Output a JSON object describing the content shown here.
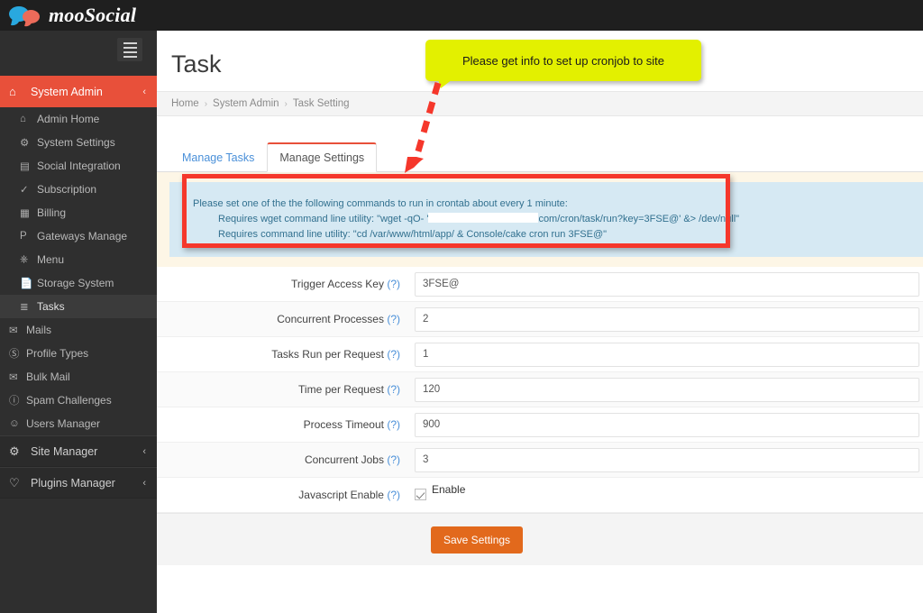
{
  "brand": {
    "name": "mooSocial"
  },
  "sidebar": {
    "toggle_icon": "hamburger-icon",
    "sections": [
      {
        "label": "System Admin",
        "icon": "home-icon",
        "chevron": "‹",
        "active": true
      },
      {
        "label": "Site Manager",
        "icon": "gears-icon",
        "chevron": "‹",
        "active": false
      },
      {
        "label": "Plugins Manager",
        "icon": "plug-icon",
        "chevron": "‹",
        "active": false
      }
    ],
    "items": [
      {
        "label": "Admin Home",
        "icon": "home-outline-icon"
      },
      {
        "label": "System Settings",
        "icon": "gear-icon"
      },
      {
        "label": "Social Integration",
        "icon": "share-icon"
      },
      {
        "label": "Subscription",
        "icon": "check-icon"
      },
      {
        "label": "Billing",
        "icon": "card-icon"
      },
      {
        "label": "Gateways Manage",
        "icon": "paypal-icon"
      },
      {
        "label": "Menu",
        "icon": "sitemap-icon"
      },
      {
        "label": "Storage System",
        "icon": "file-icon"
      },
      {
        "label": "Tasks",
        "icon": "list-icon",
        "active": true
      },
      {
        "label": "Mails",
        "icon": "envelope-icon",
        "flush": true
      },
      {
        "label": "Profile Types",
        "icon": "circle-check-icon",
        "flush": true
      },
      {
        "label": "Bulk Mail",
        "icon": "envelope-icon",
        "flush": true
      },
      {
        "label": "Spam Challenges",
        "icon": "question-circle-icon",
        "flush": true
      },
      {
        "label": "Users Manager",
        "icon": "user-icon",
        "flush": true
      }
    ]
  },
  "page": {
    "title": "Task",
    "breadcrumb": [
      "Home",
      "System Admin",
      "Task Setting"
    ],
    "breadcrumb_separator": "›"
  },
  "tabs": [
    {
      "label": "Manage Tasks",
      "active": false
    },
    {
      "label": "Manage Settings",
      "active": true
    }
  ],
  "alert": {
    "line1": "Please set one of the the following commands to run in crontab about every 1 minute:",
    "line2_prefix": "Requires wget command line utility: \"wget -qO- '",
    "line2_redacted": true,
    "line2_suffix": "com/cron/task/run?key=3FSE@' &> /dev/null\"",
    "line3": "Requires command line utility: \"cd /var/www/html/app/ & Console/cake cron run 3FSE@\""
  },
  "form": {
    "rows": [
      {
        "label": "Trigger Access Key",
        "hint": "(?)",
        "value": "3FSE@",
        "type": "text"
      },
      {
        "label": "Concurrent Processes",
        "hint": "(?)",
        "value": "2",
        "type": "text"
      },
      {
        "label": "Tasks Run per Request",
        "hint": "(?)",
        "value": "1",
        "type": "text"
      },
      {
        "label": "Time per Request",
        "hint": "(?)",
        "value": "120",
        "type": "text"
      },
      {
        "label": "Process Timeout",
        "hint": "(?)",
        "value": "900",
        "type": "text"
      },
      {
        "label": "Concurrent Jobs",
        "hint": "(?)",
        "value": "3",
        "type": "text"
      },
      {
        "label": "Javascript Enable",
        "hint": "(?)",
        "value": "Enable",
        "type": "checkbox",
        "checked": true
      }
    ],
    "save_label": "Save Settings"
  },
  "annotation": {
    "callout_text": "Please get info to set up cronjob to site",
    "callout_color": "#e3f000",
    "arrow_color": "#f5372b",
    "highlight_color": "#f5372b"
  },
  "colors": {
    "brand_red": "#e8503a",
    "sidebar_bg": "#2f2f2f",
    "topbar_bg": "#1f1f1f",
    "save_button": "#e2691c",
    "alert_bg": "#d6e9f3",
    "alert_text": "#31708f",
    "panel_cream": "#fdf6e6",
    "link_blue": "#4a90d9"
  }
}
